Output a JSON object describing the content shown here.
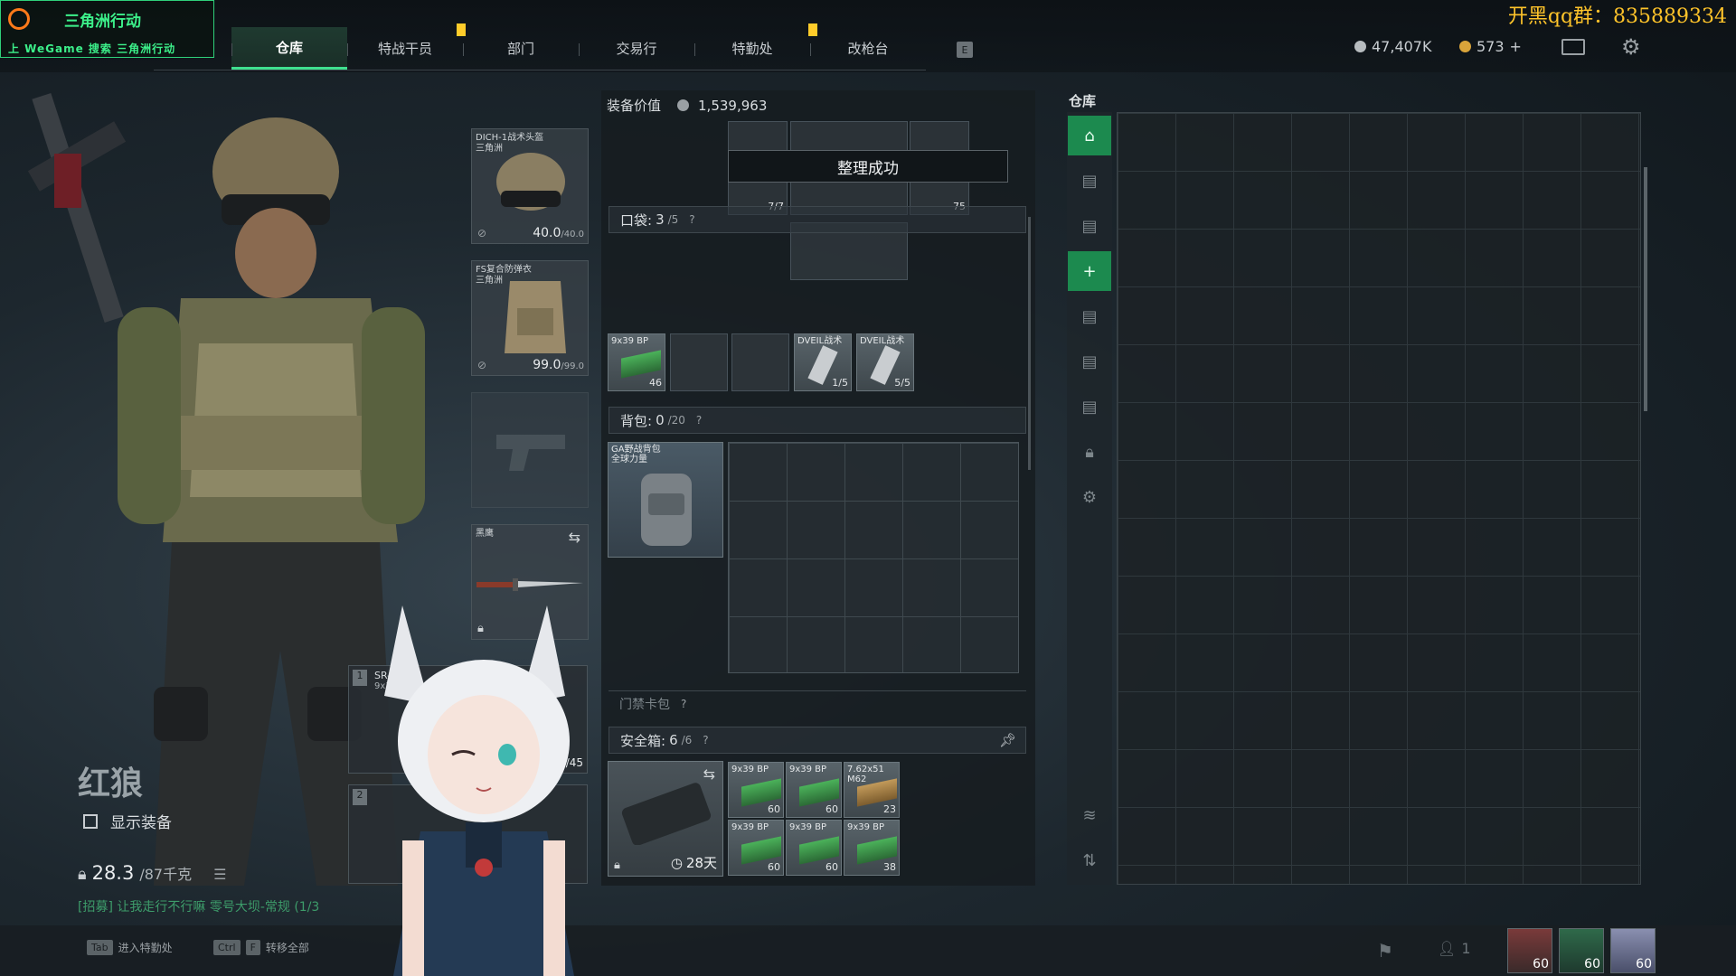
{
  "watermark": "开黑qq群：835889334",
  "logo": {
    "title": "三角洲行动",
    "wegame": "上 WeGame 搜索 三角洲行动"
  },
  "nav": {
    "tabs": [
      {
        "label": "仓库",
        "active": true
      },
      {
        "label": "特战干员"
      },
      {
        "label": "部门"
      },
      {
        "label": "交易行"
      },
      {
        "label": "特勤处"
      },
      {
        "label": "改枪台"
      }
    ],
    "hotkey_right": "E"
  },
  "currency": {
    "silver": "47,407K",
    "gold": "573",
    "gold_add": "+"
  },
  "operator": {
    "name": "红狼",
    "show_gear_label": "显示装备",
    "weight_value": "28.3",
    "weight_max": "/87千克",
    "recruit_msg": "[招募] 让我走行不行嘛  零号大坝-常规 (1/3"
  },
  "equipment": {
    "helmet": {
      "name": "DICH-1战术头盔",
      "sub": "三角洲",
      "durability": "40.0",
      "max": "/40.0"
    },
    "armor": {
      "name": "FS复合防弹衣",
      "sub": "三角洲",
      "durability": "99.0",
      "max": "/99.0"
    },
    "melee": {
      "name": "黑鹰"
    },
    "weapon1": {
      "slot": "1",
      "name": "SR-3M",
      "ammo_type": "9x39mm",
      "ammo": "45",
      "ammo_max": "/45"
    },
    "weapon2": {
      "slot": "2"
    }
  },
  "loadout": {
    "equip_value_label": "装备价值",
    "equip_value": "1,539,963",
    "toast": "整理成功",
    "chest_items": [
      {
        "count": "7/7"
      },
      {
        "count": "75"
      }
    ],
    "pocket": {
      "label": "口袋:",
      "used": "3",
      "cap": "/5",
      "help": "?",
      "items": [
        {
          "name": "9x39 BP",
          "count": "46"
        },
        {
          "name": "DVEIL战术",
          "count": "1/5"
        },
        {
          "name": "DVEIL战术",
          "count": "5/5"
        }
      ]
    },
    "backpack": {
      "label": "背包:",
      "used": "0",
      "cap": "/20",
      "help": "?",
      "item_name": "GA野战背包",
      "item_sub": "全球力量"
    },
    "keycard": {
      "label": "门禁卡包",
      "help": "?"
    },
    "safebox": {
      "label": "安全箱:",
      "used": "6",
      "cap": "/6",
      "help": "?",
      "expire": "28天",
      "items": [
        {
          "name": "9x39 BP",
          "count": "60"
        },
        {
          "name": "9x39 BP",
          "count": "60"
        },
        {
          "name": "7.62x51 M62",
          "count": "23"
        },
        {
          "name": "9x39 BP",
          "count": "60"
        },
        {
          "name": "9x39 BP",
          "count": "60"
        },
        {
          "name": "9x39 BP",
          "count": "38"
        }
      ]
    }
  },
  "warehouse": {
    "title": "仓库"
  },
  "bottom": {
    "hotkeys": [
      {
        "key": "Tab",
        "label": "进入特勤处"
      },
      {
        "key": "Ctrl",
        "key2": "F",
        "label": "转移全部"
      }
    ],
    "friends_count": "1",
    "squad": [
      {
        "level": "60"
      },
      {
        "level": "60"
      },
      {
        "level": "60"
      }
    ]
  },
  "colors": {
    "accent": "#3fe08f",
    "accent_dark": "#1c8a4f",
    "watermark": "#ffc42a"
  }
}
